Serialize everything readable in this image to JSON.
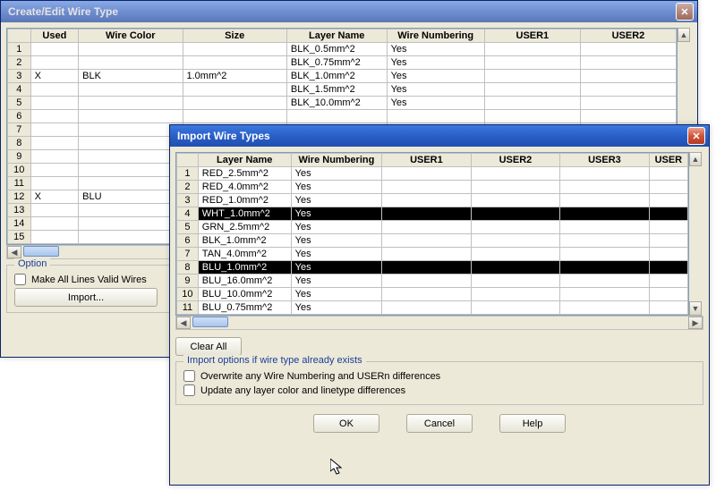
{
  "parent_window": {
    "title": "Create/Edit Wire Type",
    "columns": [
      "Used",
      "Wire Color",
      "Size",
      "Layer Name",
      "Wire Numbering",
      "USER1",
      "USER2"
    ],
    "rows": [
      {
        "n": 1,
        "used": "",
        "color": "",
        "size": "",
        "layer": "BLK_0.5mm^2",
        "num": "Yes"
      },
      {
        "n": 2,
        "used": "",
        "color": "",
        "size": "",
        "layer": "BLK_0.75mm^2",
        "num": "Yes"
      },
      {
        "n": 3,
        "used": "X",
        "color": "BLK",
        "size": "1.0mm^2",
        "layer": "BLK_1.0mm^2",
        "num": "Yes"
      },
      {
        "n": 4,
        "used": "",
        "color": "",
        "size": "",
        "layer": "BLK_1.5mm^2",
        "num": "Yes"
      },
      {
        "n": 5,
        "used": "",
        "color": "",
        "size": "",
        "layer": "BLK_10.0mm^2",
        "num": "Yes"
      },
      {
        "n": 6,
        "used": "",
        "color": "",
        "size": "",
        "layer": "",
        "num": ""
      },
      {
        "n": 7,
        "used": "",
        "color": "",
        "size": "",
        "layer": "",
        "num": ""
      },
      {
        "n": 8,
        "used": "",
        "color": "",
        "size": "",
        "layer": "",
        "num": ""
      },
      {
        "n": 9,
        "used": "",
        "color": "",
        "size": "",
        "layer": "",
        "num": ""
      },
      {
        "n": 10,
        "used": "",
        "color": "",
        "size": "",
        "layer": "",
        "num": ""
      },
      {
        "n": 11,
        "used": "",
        "color": "",
        "size": "",
        "layer": "",
        "num": ""
      },
      {
        "n": 12,
        "used": "X",
        "color": "BLU",
        "size": "",
        "layer": "",
        "num": ""
      },
      {
        "n": 13,
        "used": "",
        "color": "",
        "size": "",
        "layer": "",
        "num": ""
      },
      {
        "n": 14,
        "used": "",
        "color": "",
        "size": "",
        "layer": "",
        "num": ""
      },
      {
        "n": 15,
        "used": "",
        "color": "",
        "size": "",
        "layer": "",
        "num": ""
      }
    ],
    "option_legend": "Option",
    "make_all_valid": "Make All Lines Valid Wires",
    "import_btn": "Import..."
  },
  "child_window": {
    "title": "Import Wire Types",
    "columns": [
      "Layer Name",
      "Wire Numbering",
      "USER1",
      "USER2",
      "USER3",
      "USER"
    ],
    "rows": [
      {
        "n": 1,
        "layer": "RED_2.5mm^2",
        "num": "Yes",
        "sel": false
      },
      {
        "n": 2,
        "layer": "RED_4.0mm^2",
        "num": "Yes",
        "sel": false
      },
      {
        "n": 3,
        "layer": "RED_1.0mm^2",
        "num": "Yes",
        "sel": false
      },
      {
        "n": 4,
        "layer": "WHT_1.0mm^2",
        "num": "Yes",
        "sel": true
      },
      {
        "n": 5,
        "layer": "GRN_2.5mm^2",
        "num": "Yes",
        "sel": false
      },
      {
        "n": 6,
        "layer": "BLK_1.0mm^2",
        "num": "Yes",
        "sel": false
      },
      {
        "n": 7,
        "layer": "TAN_4.0mm^2",
        "num": "Yes",
        "sel": false
      },
      {
        "n": 8,
        "layer": "BLU_1.0mm^2",
        "num": "Yes",
        "sel": true
      },
      {
        "n": 9,
        "layer": "BLU_16.0mm^2",
        "num": "Yes",
        "sel": false
      },
      {
        "n": 10,
        "layer": "BLU_10.0mm^2",
        "num": "Yes",
        "sel": false
      },
      {
        "n": 11,
        "layer": "BLU_0.75mm^2",
        "num": "Yes",
        "sel": false
      }
    ],
    "clear_all": "Clear All",
    "import_options_legend": "Import options if wire type already exists",
    "overwrite_label": "Overwrite any Wire Numbering and USERn differences",
    "update_label": "Update any layer color and linetype differences",
    "ok": "OK",
    "cancel": "Cancel",
    "help": "Help"
  }
}
